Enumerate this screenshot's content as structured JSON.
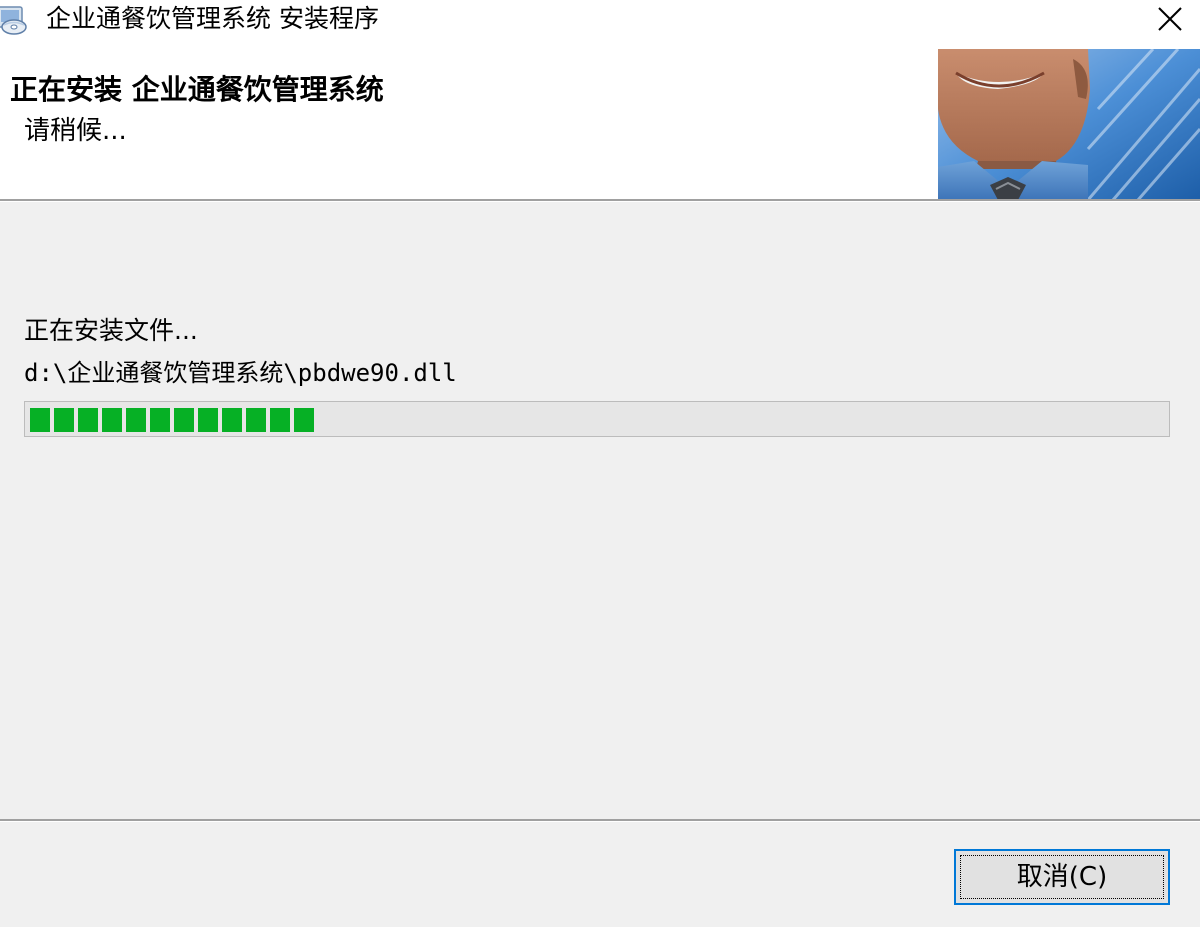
{
  "window": {
    "title": "企业通餐饮管理系统 安装程序",
    "icon": "installer-disc-icon",
    "close_icon": "close-icon"
  },
  "header": {
    "title": "正在安装 企业通餐饮管理系统",
    "subtitle": "请稍候...",
    "banner_image": "smiling-man-photo"
  },
  "main": {
    "status_text": "正在安装文件...",
    "current_file": "d:\\企业通餐饮管理系统\\pbdwe90.dll",
    "progress": {
      "filled_blocks": 12,
      "fraction": 0.255,
      "fill_color": "#06b025"
    }
  },
  "footer": {
    "cancel_label": "取消(C)"
  },
  "colors": {
    "background": "#f0f0f0",
    "header_background": "#ffffff",
    "focus_border": "#0078d7",
    "progress_green": "#06b025"
  }
}
